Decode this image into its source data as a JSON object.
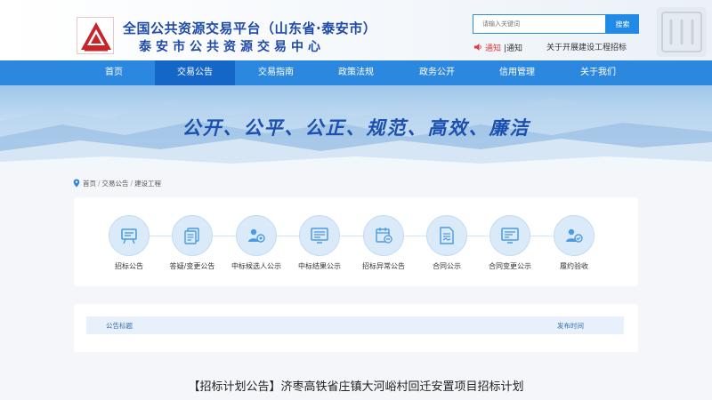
{
  "header": {
    "title_main": "全国公共资源交易平台（山东省·泰安市）",
    "title_sub": "泰安市公共资源交易中心",
    "search_placeholder": "请输入关键词",
    "search_button": "搜索",
    "notice_label": "通知",
    "notice_text": "|通知",
    "notice_marquee": "关于开展建设工程招标",
    "accent_color": "#2c88df",
    "active_nav_color": "#1467c6",
    "notice_color": "#e03a3a"
  },
  "nav": {
    "items": [
      {
        "label": "首页"
      },
      {
        "label": "交易公告"
      },
      {
        "label": "交易指南"
      },
      {
        "label": "政策法规"
      },
      {
        "label": "政务公开"
      },
      {
        "label": "信用管理"
      },
      {
        "label": "关于我们"
      }
    ],
    "active_index": 1
  },
  "banner": {
    "slogan": "公开、公平、公正、规范、高效、廉洁"
  },
  "breadcrumb": {
    "items": [
      "首页",
      "交易公告",
      "建设工程"
    ],
    "icon": "location-pin-icon"
  },
  "categories": {
    "items": [
      {
        "label": "招标公告",
        "icon": "billboard-icon"
      },
      {
        "label": "答疑/变更公告",
        "icon": "documents-icon"
      },
      {
        "label": "中标候选人公示",
        "icon": "user-badge-icon"
      },
      {
        "label": "中标结果公示",
        "icon": "screen-list-icon"
      },
      {
        "label": "招标异常公告",
        "icon": "calendar-minus-icon"
      },
      {
        "label": "合同公示",
        "icon": "contract-icon"
      },
      {
        "label": "合同变更公示",
        "icon": "screen-edit-icon"
      },
      {
        "label": "履约验收",
        "icon": "user-check-icon"
      }
    ]
  },
  "table": {
    "col_title": "公告标题",
    "col_date": "发布时间"
  },
  "document": {
    "title": "【招标计划公告】济枣高铁省庄镇大河峪村回迁安置项目招标计划"
  }
}
